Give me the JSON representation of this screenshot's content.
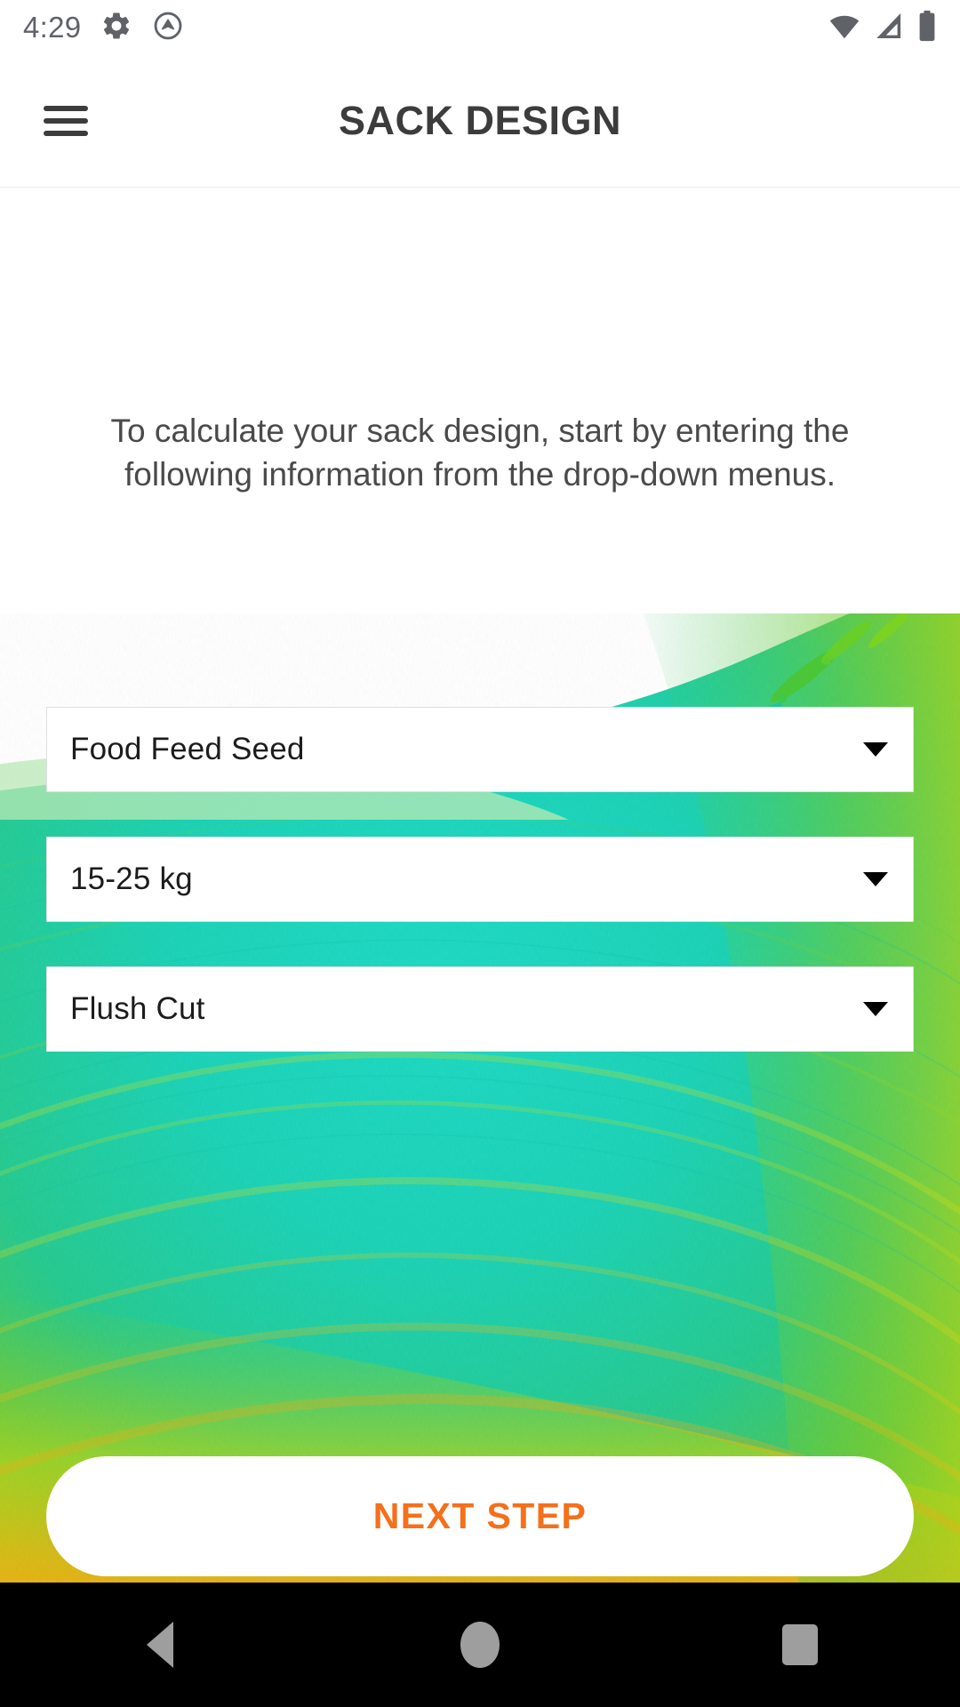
{
  "status_bar": {
    "time": "4:29",
    "left_icons": [
      "gear-icon",
      "circled-arrow-icon"
    ],
    "right_icons": [
      "wifi-icon",
      "cellular-signal-icon",
      "battery-icon"
    ]
  },
  "app_bar": {
    "menu_icon": "hamburger-menu-icon",
    "title": "SACK DESIGN"
  },
  "main": {
    "instruction": "To calculate your sack design, start by entering the following information from the drop-down menus.",
    "dropdowns": [
      {
        "name": "product-type",
        "value": "Food Feed Seed",
        "caret": "chevron-down-icon"
      },
      {
        "name": "sack-weight",
        "value": "15-25 kg",
        "caret": "chevron-down-icon"
      },
      {
        "name": "cut-type",
        "value": "Flush Cut",
        "caret": "chevron-down-icon"
      }
    ],
    "cta": {
      "label": "NEXT STEP"
    }
  },
  "nav_bar": {
    "back": "back-triangle-icon",
    "home": "home-circle-icon",
    "recents": "recents-square-icon"
  },
  "colors": {
    "accent_orange": "#f4701b",
    "title_gray": "#3c3c3c",
    "body_gray": "#4a4a4a",
    "art_teal": "#17cfb4",
    "art_green": "#63c52b",
    "art_yellow": "#f2c90b",
    "art_orange": "#f7a80d",
    "nav_black": "#000000"
  }
}
